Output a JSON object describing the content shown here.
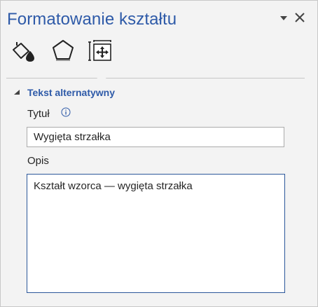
{
  "pane": {
    "title": "Formatowanie kształtu",
    "menu_icon": "chevron-down-icon",
    "close_icon": "close-icon"
  },
  "tabs": [
    {
      "icon": "fill-bucket-icon",
      "selected": false
    },
    {
      "icon": "pentagon-effects-icon",
      "selected": false
    },
    {
      "icon": "size-properties-icon",
      "selected": true
    }
  ],
  "section": {
    "title": "Tekst alternatywny",
    "expanded": true
  },
  "fields": {
    "title_label": "Tytuł",
    "title_value": "Wygięta strzałka",
    "description_label": "Opis",
    "description_value": "Kształt wzorca — wygięta strzałka"
  },
  "colors": {
    "accent": "#2e5aa8",
    "focus_border": "#2b579a",
    "background": "#f3f3f3"
  }
}
